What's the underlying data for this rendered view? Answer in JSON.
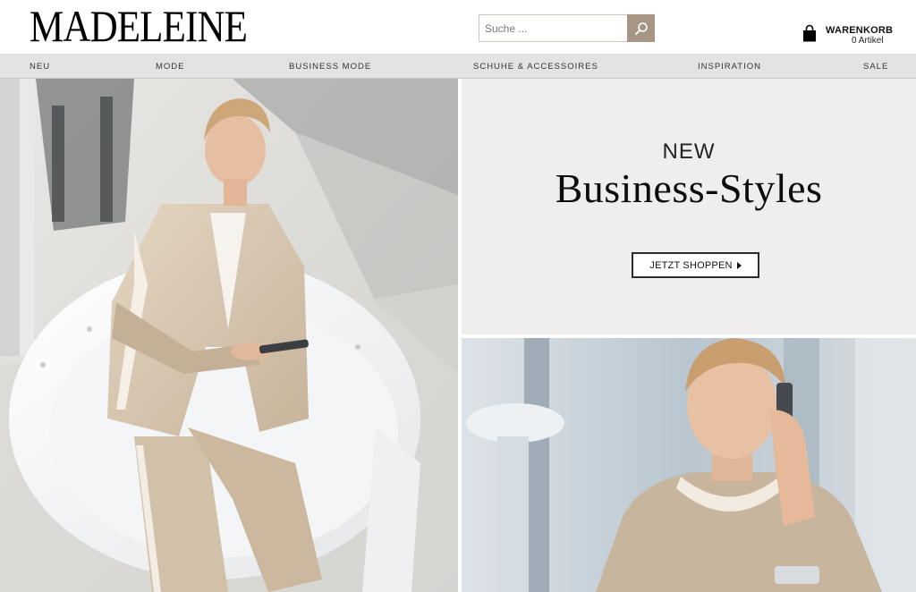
{
  "header": {
    "logo": "MADELEINE",
    "search": {
      "placeholder": "Suche ..."
    },
    "cart": {
      "title": "WARENKORB",
      "count": "0  Artikel"
    }
  },
  "nav": {
    "items": [
      {
        "label": "NEU"
      },
      {
        "label": "MODE"
      },
      {
        "label": "BUSINESS MODE"
      },
      {
        "label": "SCHUHE & ACCESSOIRES"
      },
      {
        "label": "INSPIRATION"
      },
      {
        "label": "SALE"
      }
    ]
  },
  "promo": {
    "kicker": "NEW",
    "title": "Business-Styles",
    "cta": "JETZT SHOPPEN"
  },
  "colors": {
    "accent": "#a79683",
    "nav_bg": "#e2e3e2",
    "promo_bg": "#efeeed"
  },
  "icons": [
    "search-icon",
    "shopping-bag-icon",
    "arrow-right-icon"
  ]
}
